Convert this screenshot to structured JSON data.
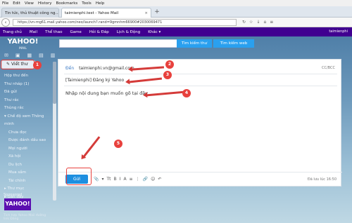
{
  "browser": {
    "menu": [
      "File",
      "Edit",
      "View",
      "History",
      "Bookmarks",
      "Tools",
      "Help"
    ],
    "tabs": [
      {
        "label": "Tin tức, thủ thuật công ng…",
        "close": "×"
      },
      {
        "label": "taimienphi.test - Yahoo Mail",
        "close": "×"
      }
    ],
    "newtab": "+",
    "url": "https://vn-mg61.mail.yahoo.com/neo/launch?.rand=9gmnhm66900#2030069471"
  },
  "yahoo_nav": {
    "items": [
      "Trang chủ",
      "Mail",
      "Thể thao",
      "Game",
      "Hỏi & Đáp",
      "Lịch & Động",
      "Khác ▾"
    ],
    "right": "taimienphi"
  },
  "header": {
    "logo": "YAHOO!",
    "logo_sub": "MAIL",
    "search_mail": "Tìm kiếm thư",
    "search_web": "Tìm kiếm web"
  },
  "sidebar": {
    "compose": "Viết thư",
    "folders": [
      "Hộp thư đến",
      "Thư nháp (1)",
      "Đã gửi",
      "Thư rác",
      "Thùng rác",
      "▾ Chế độ xem Thông minh"
    ],
    "smart_views": [
      "Chưa đọc",
      "Được đánh dấu sao",
      "Mọi người",
      "Xã hội",
      "Du lịch",
      "Mua sắm",
      "Tài chính"
    ],
    "more": [
      "▸ Thư mục",
      "▸ Gần đây"
    ],
    "sponsored": "Sponsored",
    "ad_text": "YAHOO!",
    "footer": "Tích hợp Yahoo Mail đường link Đăng"
  },
  "compose": {
    "to_label": "Đến",
    "to_value": "taimienphi.vn@gmail.com",
    "cc_bcc": "CC/BCC",
    "subject": "[Taimienphi] Đăng ký Yahoo",
    "body": "Nhập nội dung bạn muốn gõ tại đây",
    "send": "Gửi",
    "toolbar_icons": [
      "📎",
      "▾",
      "Tt",
      "B",
      "I",
      "A",
      "≡",
      "⋮",
      "🔗",
      "☺",
      "↶"
    ],
    "saved": "Đã lưu lúc 16:50"
  },
  "callouts": [
    "1",
    "2",
    "3",
    "4",
    "5"
  ],
  "colors": {
    "accent": "#400090",
    "send": "#1d8fe0",
    "callout": "#e8413d"
  }
}
